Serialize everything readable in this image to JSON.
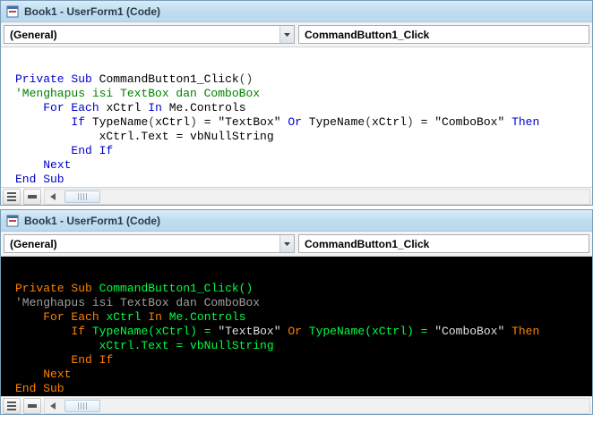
{
  "window1": {
    "title": "Book1 - UserForm1 (Code)",
    "object_dropdown": "(General)",
    "procedure_dropdown": "CommandButton1_Click",
    "code_tokens": [
      [
        "\n"
      ],
      [
        "kw",
        "Private Sub"
      ],
      [
        "plain",
        " "
      ],
      [
        "ident",
        "CommandButton1_Click"
      ],
      [
        "paren",
        "()"
      ],
      [
        "\n"
      ],
      [
        "cm",
        "'Menghapus isi TextBox dan ComboBox"
      ],
      [
        "\n"
      ],
      [
        "plain",
        "    "
      ],
      [
        "kw",
        "For Each"
      ],
      [
        "plain",
        " "
      ],
      [
        "ident",
        "xCtrl"
      ],
      [
        "plain",
        " "
      ],
      [
        "kw",
        "In"
      ],
      [
        "plain",
        " "
      ],
      [
        "ident",
        "Me.Controls"
      ],
      [
        "\n"
      ],
      [
        "plain",
        "        "
      ],
      [
        "kw",
        "If"
      ],
      [
        "plain",
        " "
      ],
      [
        "ident",
        "TypeName"
      ],
      [
        "paren",
        "("
      ],
      [
        "ident",
        "xCtrl"
      ],
      [
        "paren",
        ")"
      ],
      [
        "plain",
        " = "
      ],
      [
        "str",
        "\"TextBox\""
      ],
      [
        "plain",
        " "
      ],
      [
        "kw",
        "Or"
      ],
      [
        "plain",
        " "
      ],
      [
        "ident",
        "TypeName"
      ],
      [
        "paren",
        "("
      ],
      [
        "ident",
        "xCtrl"
      ],
      [
        "paren",
        ")"
      ],
      [
        "plain",
        " = "
      ],
      [
        "str",
        "\"ComboBox\""
      ],
      [
        "plain",
        " "
      ],
      [
        "kw",
        "Then"
      ],
      [
        "\n"
      ],
      [
        "plain",
        "            "
      ],
      [
        "ident",
        "xCtrl.Text"
      ],
      [
        "plain",
        " = "
      ],
      [
        "ident",
        "vbNullString"
      ],
      [
        "\n"
      ],
      [
        "plain",
        "        "
      ],
      [
        "kw",
        "End If"
      ],
      [
        "\n"
      ],
      [
        "plain",
        "    "
      ],
      [
        "kw",
        "Next"
      ],
      [
        "\n"
      ],
      [
        "kw",
        "End Sub"
      ],
      [
        "\n"
      ]
    ]
  },
  "window2": {
    "title": "Book1 - UserForm1 (Code)",
    "object_dropdown": "(General)",
    "procedure_dropdown": "CommandButton1_Click",
    "code_tokens": [
      [
        "\n"
      ],
      [
        "kw",
        "Private Sub"
      ],
      [
        "plain",
        " "
      ],
      [
        "ident",
        "CommandButton1_Click"
      ],
      [
        "paren",
        "()"
      ],
      [
        "\n"
      ],
      [
        "cm",
        "'Menghapus isi TextBox dan ComboBox"
      ],
      [
        "\n"
      ],
      [
        "plain",
        "    "
      ],
      [
        "kw",
        "For Each"
      ],
      [
        "plain",
        " "
      ],
      [
        "ident",
        "xCtrl"
      ],
      [
        "plain",
        " "
      ],
      [
        "kw",
        "In"
      ],
      [
        "plain",
        " "
      ],
      [
        "ident",
        "Me.Controls"
      ],
      [
        "\n"
      ],
      [
        "plain",
        "        "
      ],
      [
        "kw",
        "If"
      ],
      [
        "plain",
        " "
      ],
      [
        "ident",
        "TypeName"
      ],
      [
        "paren",
        "("
      ],
      [
        "ident",
        "xCtrl"
      ],
      [
        "paren",
        ")"
      ],
      [
        "plain",
        " = "
      ],
      [
        "str",
        "\"TextBox\""
      ],
      [
        "plain",
        " "
      ],
      [
        "kw",
        "Or"
      ],
      [
        "plain",
        " "
      ],
      [
        "ident",
        "TypeName"
      ],
      [
        "paren",
        "("
      ],
      [
        "ident",
        "xCtrl"
      ],
      [
        "paren",
        ")"
      ],
      [
        "plain",
        " = "
      ],
      [
        "str",
        "\"ComboBox\""
      ],
      [
        "plain",
        " "
      ],
      [
        "kw",
        "Then"
      ],
      [
        "\n"
      ],
      [
        "plain",
        "            "
      ],
      [
        "ident",
        "xCtrl.Text"
      ],
      [
        "plain",
        " = "
      ],
      [
        "ident",
        "vbNullString"
      ],
      [
        "\n"
      ],
      [
        "plain",
        "        "
      ],
      [
        "kw",
        "End If"
      ],
      [
        "\n"
      ],
      [
        "plain",
        "    "
      ],
      [
        "kw",
        "Next"
      ],
      [
        "\n"
      ],
      [
        "kw",
        "End Sub"
      ],
      [
        "\n"
      ]
    ]
  }
}
